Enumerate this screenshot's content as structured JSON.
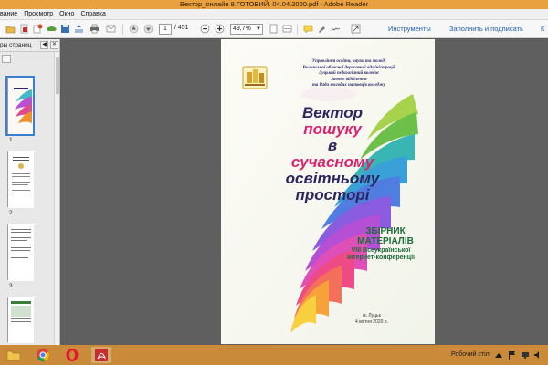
{
  "window": {
    "title": "Вектор_онлайн 8.ГОТОВИЙ. 04.04.2020.pdf - Adobe Reader"
  },
  "menubar": {
    "items": [
      "вание",
      "Просмотр",
      "Окно",
      "Справка"
    ]
  },
  "toolbar": {
    "page_current": "1",
    "page_total": "/ 451",
    "zoom": "49,7%",
    "tools_label": "Инструменты",
    "fill_sign_label": "Заполнить и подписать",
    "comment_label": "К"
  },
  "sidebar": {
    "title": "ры страниц",
    "thumbnails": [
      {
        "page": "1"
      },
      {
        "page": "2"
      },
      {
        "page": "3"
      }
    ]
  },
  "cover": {
    "org_lines": [
      "Управління освіти, науки та молоді",
      "Волинської обласної державної адміністрації",
      "Луцький педагогічний коледж",
      "Заочне відділення",
      "та Рада молодих науковців коледжу"
    ],
    "title_parts": {
      "part1": "Вектор ",
      "part1_hl": "пошуку",
      "line2_a": "в ",
      "line2_hl": "сучасному",
      "line3": "освітньому",
      "line4": "просторі"
    },
    "collection_1": "ЗБІРНИК",
    "collection_2": "МАТЕРІАЛІВ",
    "conference_1": "VIII Всеукраїнської",
    "conference_2": "інтернет-конференції",
    "city": "м. Луцьк",
    "date": "4 квітня 2020 р."
  },
  "taskbar": {
    "desktop_label": "Робочий стіл",
    "apps": [
      "file-explorer-icon",
      "chrome-icon",
      "opera-icon",
      "acrobat-icon"
    ]
  },
  "colors": {
    "title_bar": "#e9a13f",
    "taskbar": "#c98a3a",
    "link_blue": "#1f5ea8",
    "cover_title": "#2d2560",
    "cover_highlight": "#d8246e",
    "cover_green": "#1d6b3a"
  }
}
